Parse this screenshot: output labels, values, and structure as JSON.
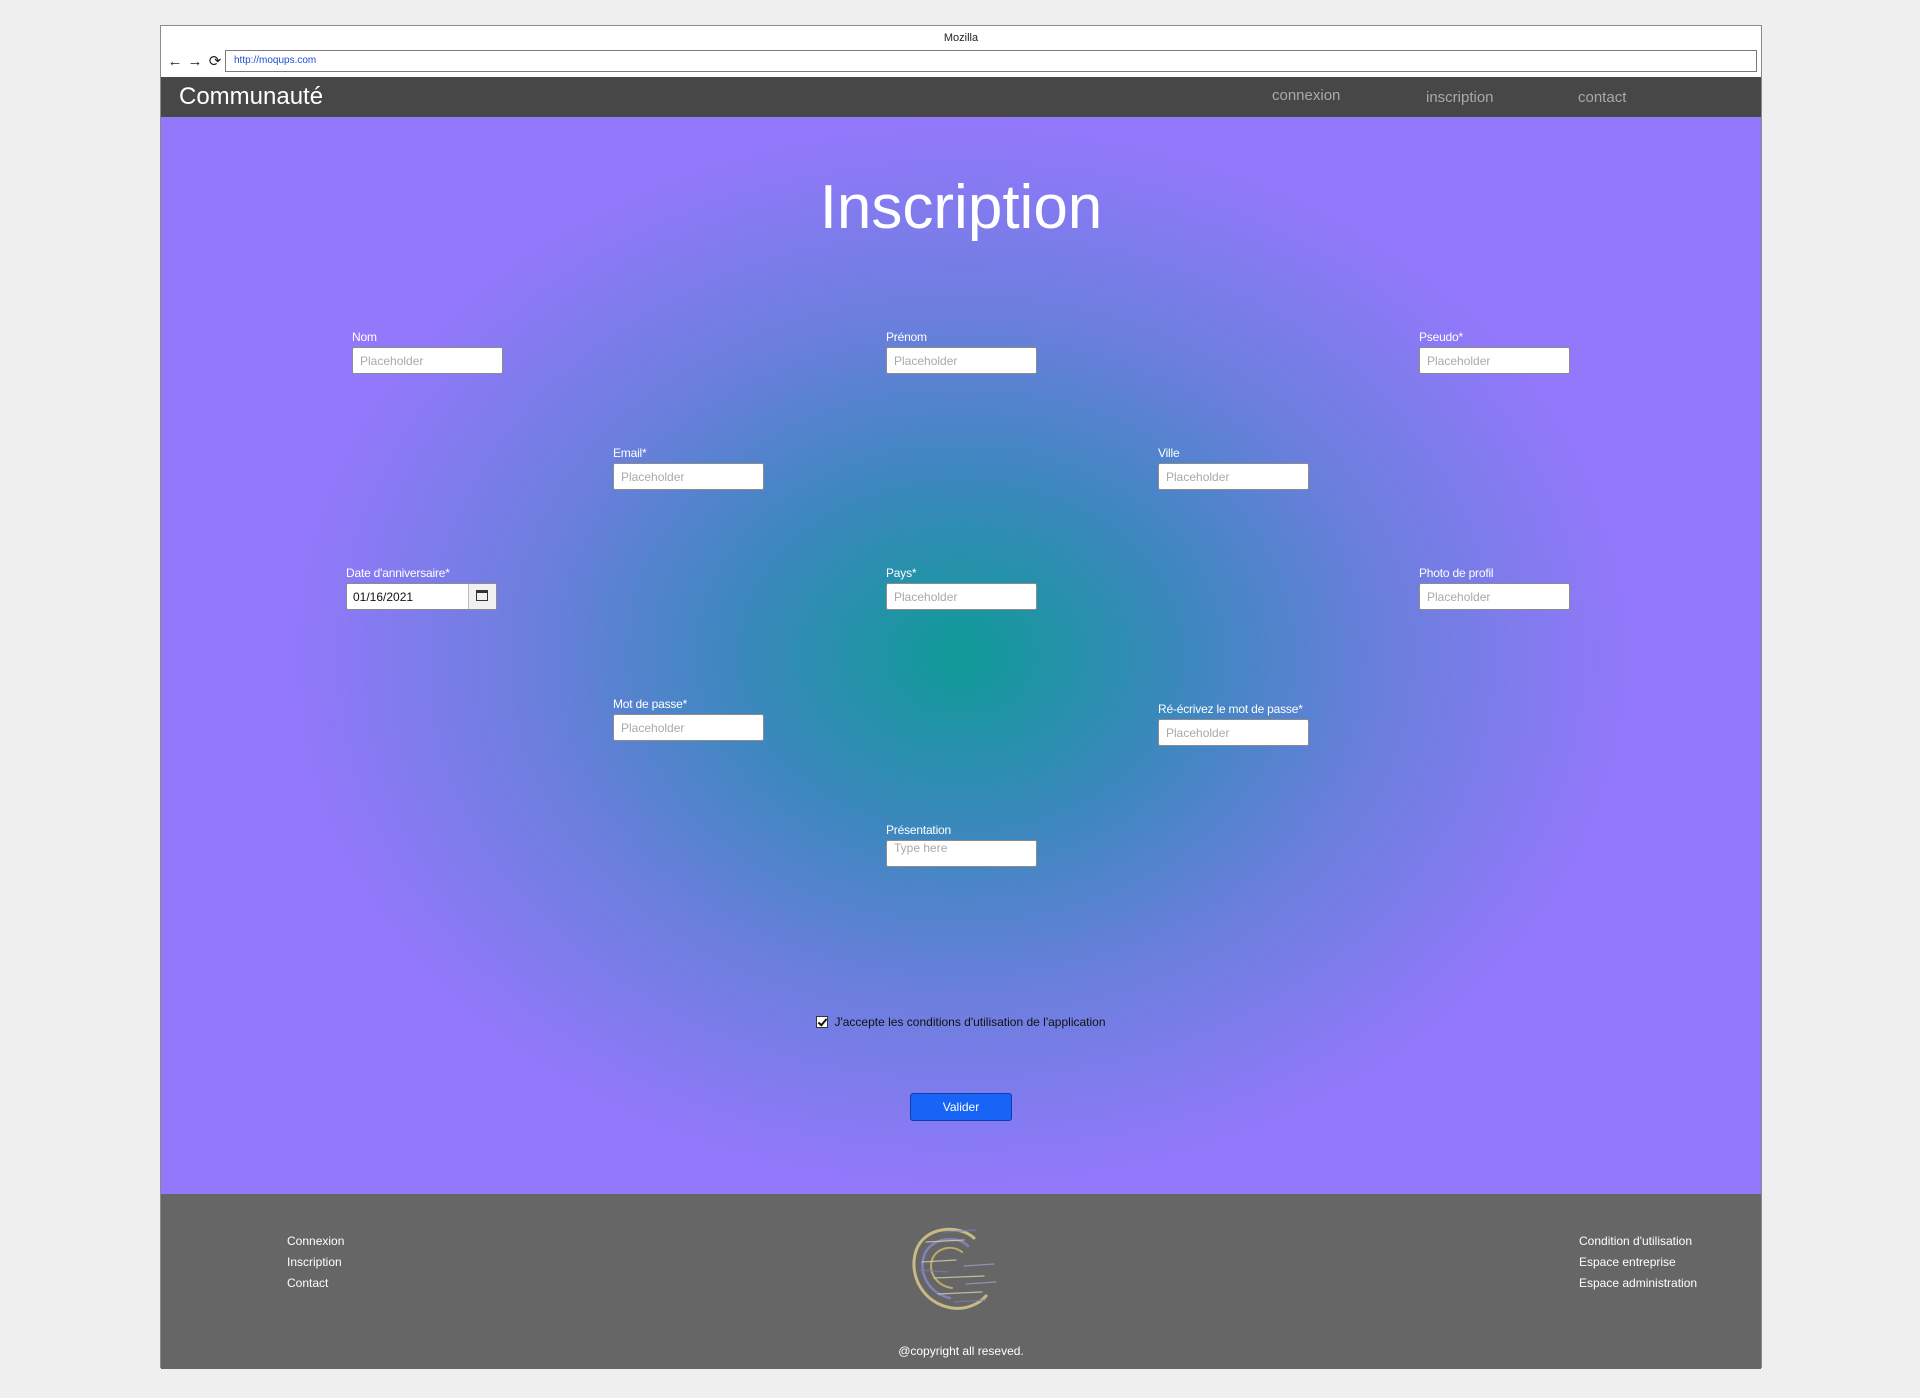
{
  "browser": {
    "title": "Mozilla",
    "url": "http://moqups.com"
  },
  "nav": {
    "brand": "Communauté",
    "links": [
      "connexion",
      "inscription",
      "contact"
    ]
  },
  "form": {
    "title": "Inscription",
    "fields": {
      "nom": {
        "label": "Nom",
        "placeholder": "Placeholder"
      },
      "prenom": {
        "label": "Prénom",
        "placeholder": "Placeholder"
      },
      "pseudo": {
        "label": "Pseudo*",
        "placeholder": "Placeholder"
      },
      "email": {
        "label": "Email*",
        "placeholder": "Placeholder"
      },
      "ville": {
        "label": "Ville",
        "placeholder": "Placeholder"
      },
      "birthday": {
        "label": "Date d'anniversaire*",
        "value": "01/16/2021"
      },
      "pays": {
        "label": "Pays*",
        "placeholder": "Placeholder"
      },
      "photo": {
        "label": "Photo de profil",
        "placeholder": "Placeholder"
      },
      "password": {
        "label": "Mot de passe*",
        "placeholder": "Placeholder"
      },
      "password_confirm": {
        "label": "Ré-écrivez le mot de passe*",
        "placeholder": "Placeholder"
      },
      "presentation": {
        "label": "Présentation",
        "placeholder": "Type here"
      }
    },
    "terms": {
      "label": "J'accepte les conditions d'utilisation de l'application",
      "checked": true
    },
    "submit_label": "Valider"
  },
  "footer": {
    "left_links": [
      "Connexion",
      "Inscription",
      "Contact"
    ],
    "right_links": [
      "Condition d'utilisation",
      "Espace entreprise",
      "Espace administration"
    ],
    "copyright": "@copyright all reseved."
  },
  "colors": {
    "nav_bg": "#474747",
    "footer_bg": "#666666",
    "gradient_center": "#0f9a97",
    "gradient_edge": "#9478fc",
    "button": "#1764f6"
  }
}
